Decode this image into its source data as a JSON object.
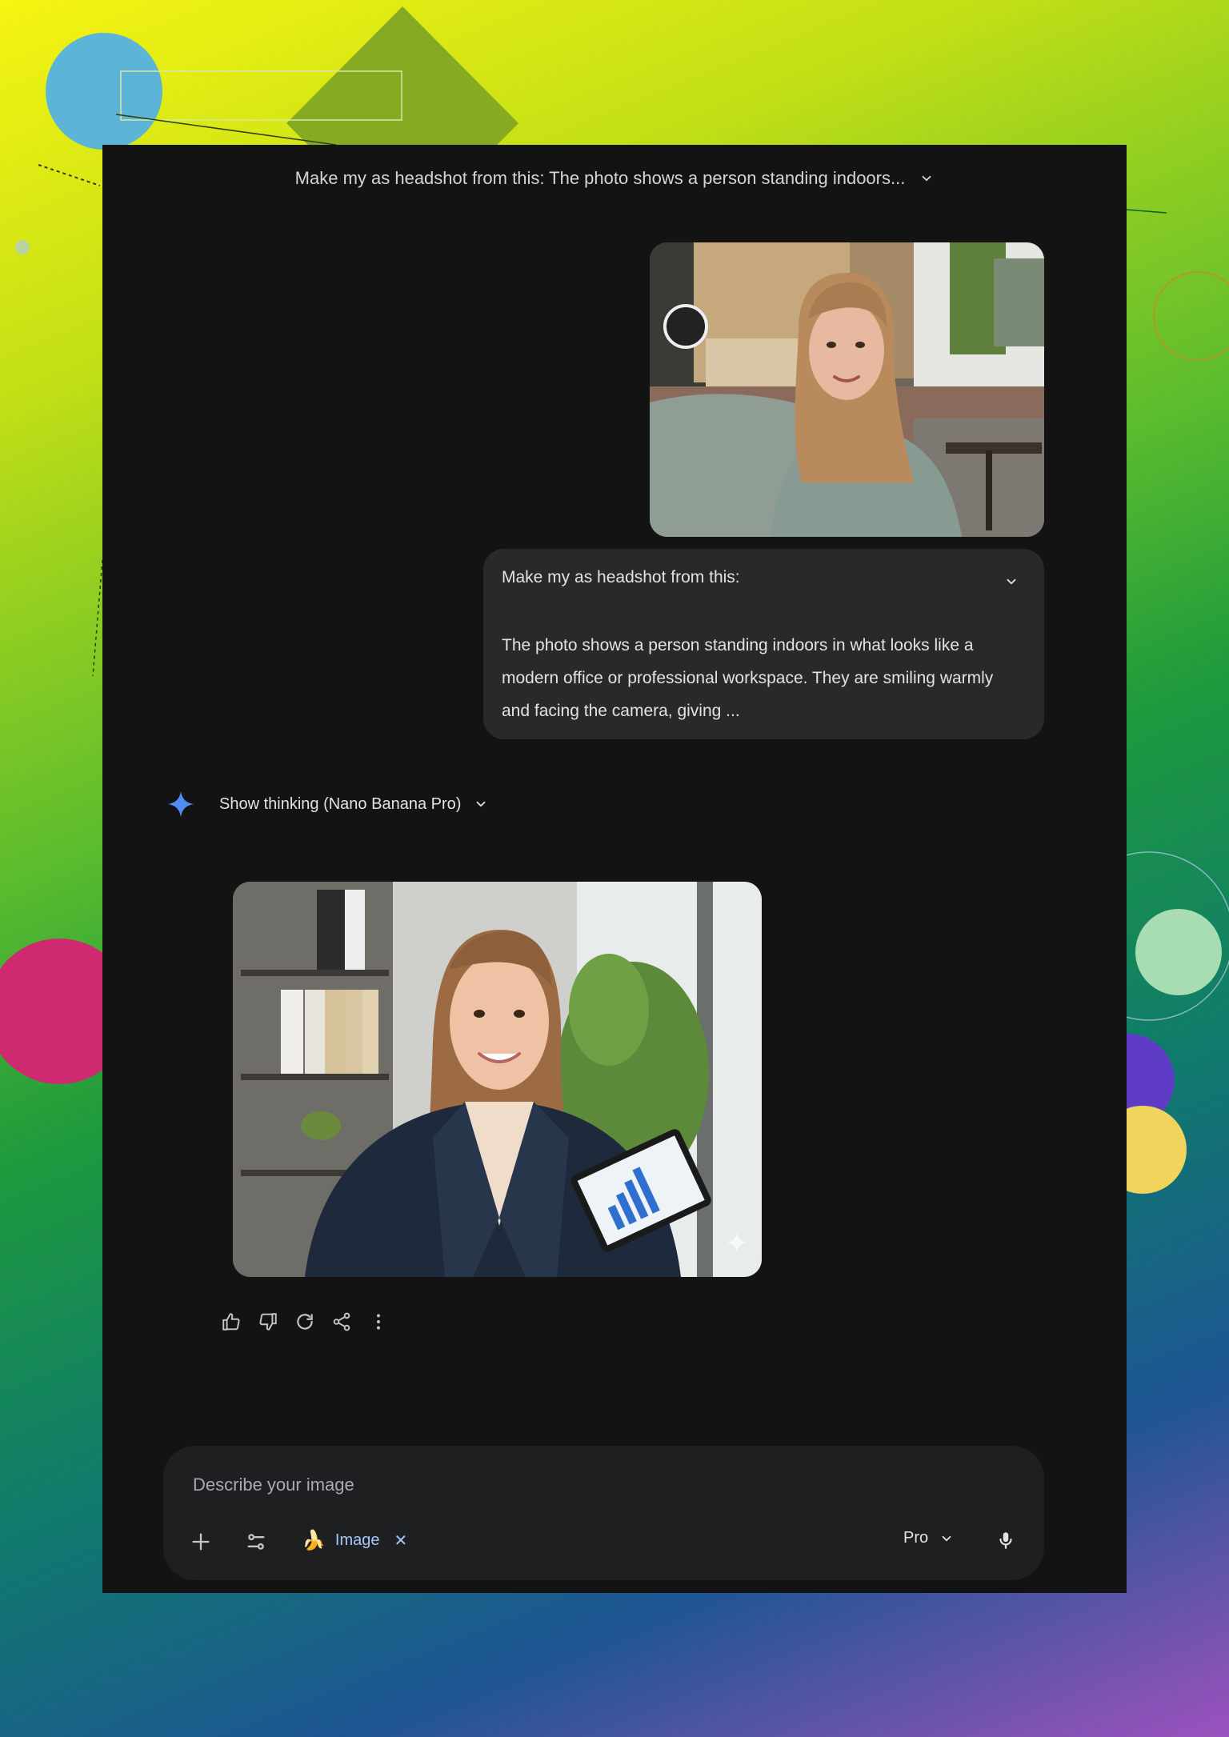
{
  "header": {
    "conversation_title": "Make my as headshot from this: The photo shows a person standing indoors..."
  },
  "user_message": {
    "attachment_icon": "photo-icon",
    "prompt_first_line": "Make my as headshot from this:",
    "prompt_body": "The photo shows a person standing indoors in what looks like a modern office or professional workspace. They are smiling warmly and facing the camera, giving ..."
  },
  "response": {
    "thinking_label": "Show thinking (Nano Banana Pro)",
    "spark_color": "#4f8df5",
    "actions": [
      "thumbs-up-icon",
      "thumbs-down-icon",
      "regenerate-icon",
      "share-icon",
      "more-vert-icon"
    ]
  },
  "composer": {
    "placeholder": "Describe your image",
    "value": "",
    "tool_chip": {
      "icon": "banana-emoji",
      "emoji": "🍌",
      "label": "Image",
      "remove": "✕"
    },
    "model_label": "Pro",
    "chip_color": "#a8c7fa"
  }
}
